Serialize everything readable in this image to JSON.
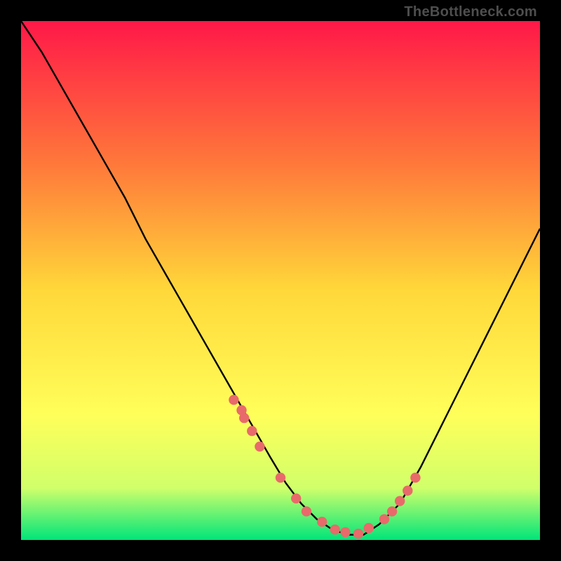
{
  "watermark": "TheBottleneck.com",
  "colors": {
    "frame": "#000000",
    "gradient_top": "#ff1848",
    "gradient_mid1": "#ff7a3a",
    "gradient_mid2": "#ffd83a",
    "gradient_mid3": "#ffff5a",
    "gradient_mid4": "#d0ff6a",
    "gradient_bot": "#00e57a",
    "curve": "#000000",
    "dots": "#e86a6a"
  },
  "chart_data": {
    "type": "line",
    "title": "",
    "xlabel": "",
    "ylabel": "",
    "xlim": [
      0,
      100
    ],
    "ylim": [
      0,
      100
    ],
    "series": [
      {
        "name": "bottleneck-curve",
        "x": [
          0,
          4,
          8,
          12,
          16,
          20,
          24,
          28,
          32,
          36,
          40,
          44,
          48,
          51,
          54,
          57,
          60,
          63,
          66,
          69,
          73,
          77,
          81,
          85,
          89,
          93,
          97,
          100
        ],
        "y": [
          100,
          94,
          87,
          80,
          73,
          66,
          58,
          51,
          44,
          37,
          30,
          23,
          16,
          11,
          7,
          4,
          2,
          1,
          1,
          3,
          7,
          14,
          22,
          30,
          38,
          46,
          54,
          60
        ]
      }
    ],
    "markers": [
      {
        "name": "highlight-dots",
        "x": [
          41,
          42.5,
          43,
          44.5,
          46,
          50,
          53,
          55,
          58,
          60.5,
          62.5,
          65,
          67,
          70,
          71.5,
          73,
          74.5,
          76
        ],
        "y": [
          27,
          25,
          23.5,
          21,
          18,
          12,
          8,
          5.5,
          3.5,
          2,
          1.5,
          1.2,
          2.3,
          4,
          5.5,
          7.5,
          9.5,
          12
        ]
      }
    ]
  }
}
